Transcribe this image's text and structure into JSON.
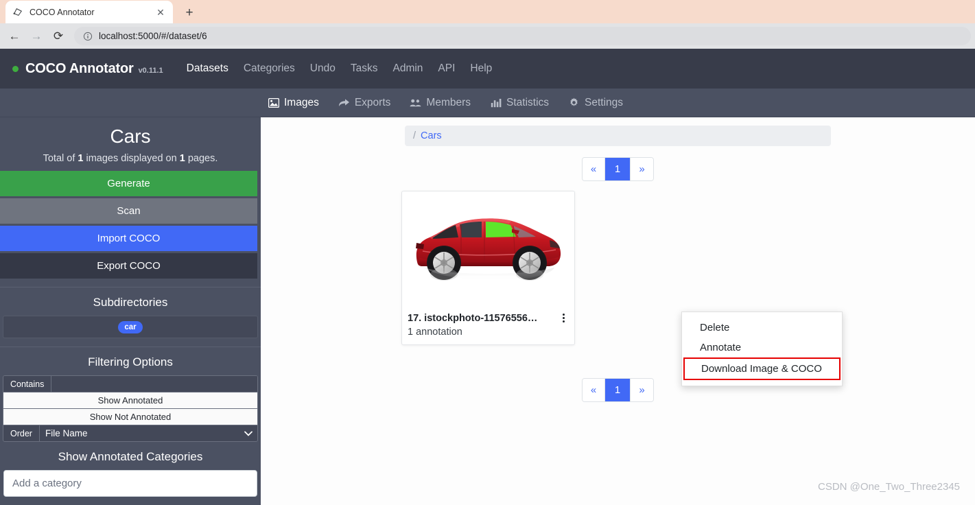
{
  "browser": {
    "tab": {
      "title": "COCO Annotator",
      "favicon_icon": "polygon-annotation-icon",
      "close_icon": "✕"
    },
    "new_tab_label": "+",
    "back_icon": "←",
    "forward_icon": "→",
    "reload_icon": "⟳",
    "site_info_icon": "info-circle-icon",
    "url": "localhost:5000/#/dataset/6"
  },
  "navbar": {
    "brand": "COCO Annotator",
    "version": "v0.11.1",
    "links": [
      {
        "label": "Datasets",
        "active": true
      },
      {
        "label": "Categories",
        "active": false
      },
      {
        "label": "Undo",
        "active": false
      },
      {
        "label": "Tasks",
        "active": false
      },
      {
        "label": "Admin",
        "active": false
      },
      {
        "label": "API",
        "active": false
      },
      {
        "label": "Help",
        "active": false
      }
    ]
  },
  "subnav": [
    {
      "label": "Images",
      "icon": "image-icon",
      "active": true
    },
    {
      "label": "Exports",
      "icon": "share-arrow-icon",
      "active": false
    },
    {
      "label": "Members",
      "icon": "users-icon",
      "active": false
    },
    {
      "label": "Statistics",
      "icon": "bar-chart-icon",
      "active": false
    },
    {
      "label": "Settings",
      "icon": "gear-icon",
      "active": false
    }
  ],
  "sidebar": {
    "dataset_title": "Cars",
    "summary_prefix": "Total of ",
    "summary_image_count": "1",
    "summary_middle": " images displayed on ",
    "summary_page_count": "1",
    "summary_suffix": " pages.",
    "buttons": {
      "generate": "Generate",
      "scan": "Scan",
      "import": "Import COCO",
      "export": "Export COCO"
    },
    "subdirectories": {
      "heading": "Subdirectories",
      "tags": [
        "car"
      ]
    },
    "filtering": {
      "heading": "Filtering Options",
      "contains_label": "Contains",
      "contains_value": "",
      "contains_placeholder": "",
      "show_annotated": "Show Annotated",
      "show_not_annotated": "Show Not Annotated",
      "order_label": "Order",
      "order_value": "File Name",
      "order_options": [
        "File Name"
      ]
    },
    "categories": {
      "heading": "Show Annotated Categories",
      "input_value": "",
      "input_placeholder": "Add a category"
    }
  },
  "main": {
    "breadcrumb": {
      "separator": "/",
      "current": "Cars"
    },
    "pagination_top": {
      "prev": "«",
      "pages": [
        "1"
      ],
      "next": "»",
      "active_page": "1"
    },
    "pagination_bottom": {
      "prev": "«",
      "pages": [
        "1"
      ],
      "next": "»",
      "active_page": "1"
    },
    "image_card": {
      "title": "17. istockphoto-11576556…",
      "annotation_text": "1 annotation",
      "kebab_icon": "vertical-dots-icon",
      "thumbnail_alt": "red-suv-side-view"
    },
    "context_menu": [
      {
        "label": "Delete",
        "highlighted": false
      },
      {
        "label": "Annotate",
        "highlighted": false
      },
      {
        "label": "Download Image & COCO",
        "highlighted": true
      }
    ],
    "watermark": "CSDN @One_Two_Three2345"
  },
  "colors": {
    "navbar_bg": "#383c4a",
    "sidebar_bg": "#4b5162",
    "accent_blue": "#4169f6",
    "green": "#39a14a",
    "highlight_red": "#e60000",
    "tabstrip_bg": "#f7dbcc"
  }
}
